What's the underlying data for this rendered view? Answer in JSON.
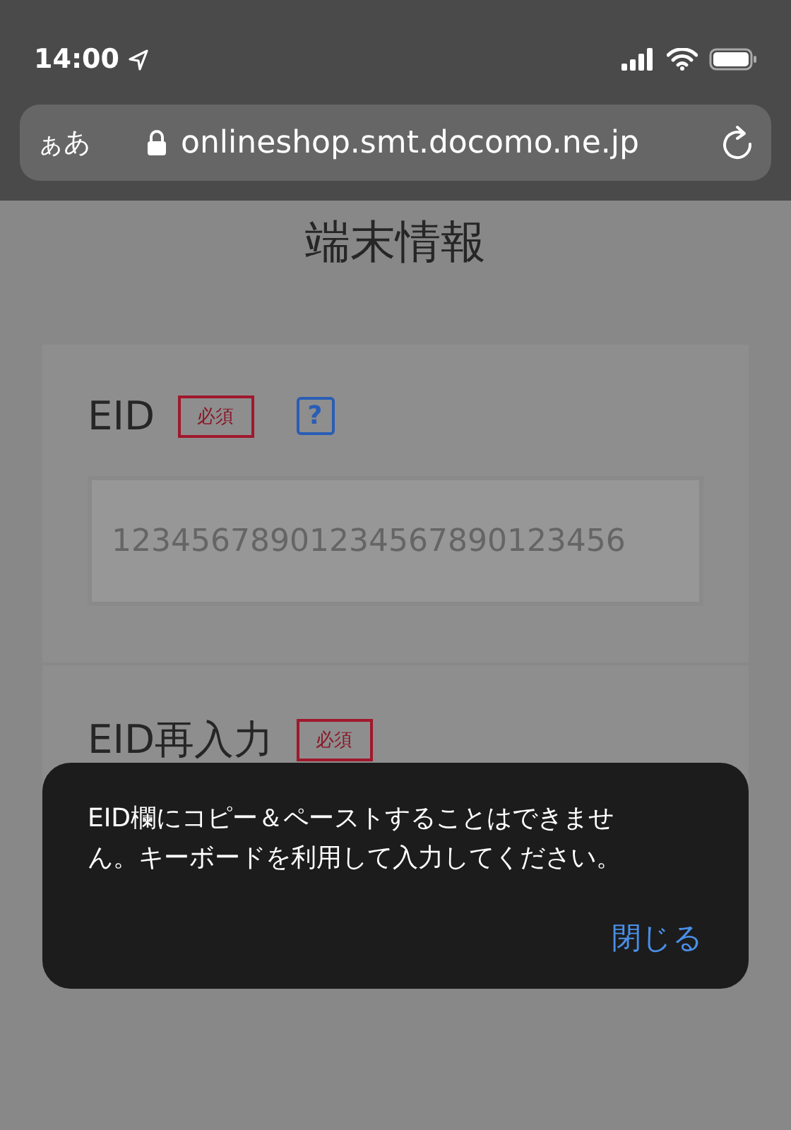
{
  "status_bar": {
    "time": "14:00"
  },
  "address_bar": {
    "text_size_button": "ぁあ",
    "url": "onlineshop.smt.docomo.ne.jp"
  },
  "page": {
    "title": "端末情報",
    "fields": [
      {
        "label": "EID",
        "badge": "必須",
        "help": "?",
        "value": "12345678901234567890123456"
      },
      {
        "label": "EID再入力",
        "badge": "必須"
      }
    ]
  },
  "dialog": {
    "message": "EID欄にコピー＆ペーストすることはできません。キーボードを利用して入力してください。",
    "button": "閉じる"
  }
}
